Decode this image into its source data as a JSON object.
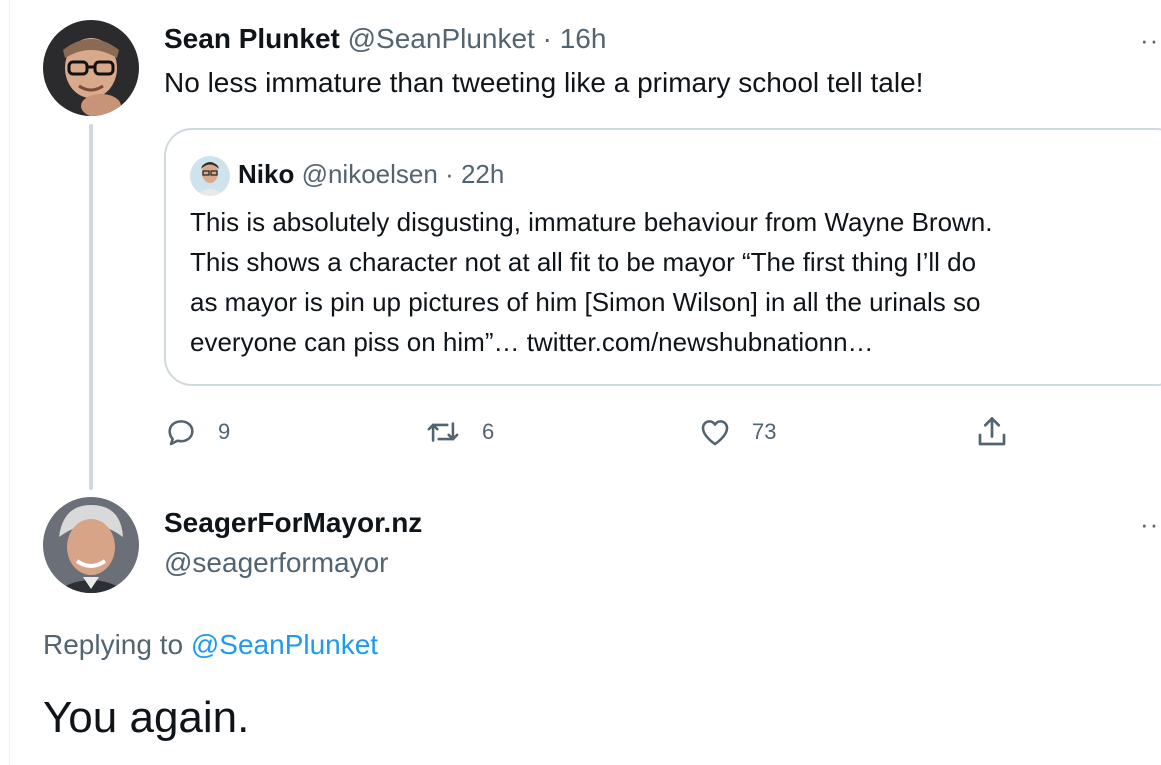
{
  "tweet1": {
    "name": "Sean Plunket",
    "handle": "@SeanPlunket",
    "separator": "·",
    "time": "16h",
    "text": "No less immature than tweeting like a primary school tell tale!",
    "more": "··",
    "quote": {
      "name": "Niko",
      "handle": "@nikoelsen",
      "separator": "·",
      "time": "22h",
      "lines": [
        "This is absolutely disgusting, immature behaviour from Wayne Brown.",
        "This shows a character not at all fit to be mayor “The first thing I’ll do",
        "as mayor is pin up pictures of him [Simon Wilson] in all the urinals so",
        "everyone can piss on him”… twitter.com/newshubnationn…"
      ]
    },
    "actions": {
      "replies": "9",
      "retweets": "6",
      "likes": "73"
    }
  },
  "tweet2": {
    "name": "SeagerForMayor.nz",
    "handle": "@seagerformayor",
    "more": "··",
    "replying_prefix": "Replying to",
    "replying_to": "@SeanPlunket",
    "text": "You again."
  },
  "colors": {
    "text": "#0f1419",
    "muted": "#536471",
    "link": "#1d9bf0",
    "border": "#cfd9de"
  }
}
